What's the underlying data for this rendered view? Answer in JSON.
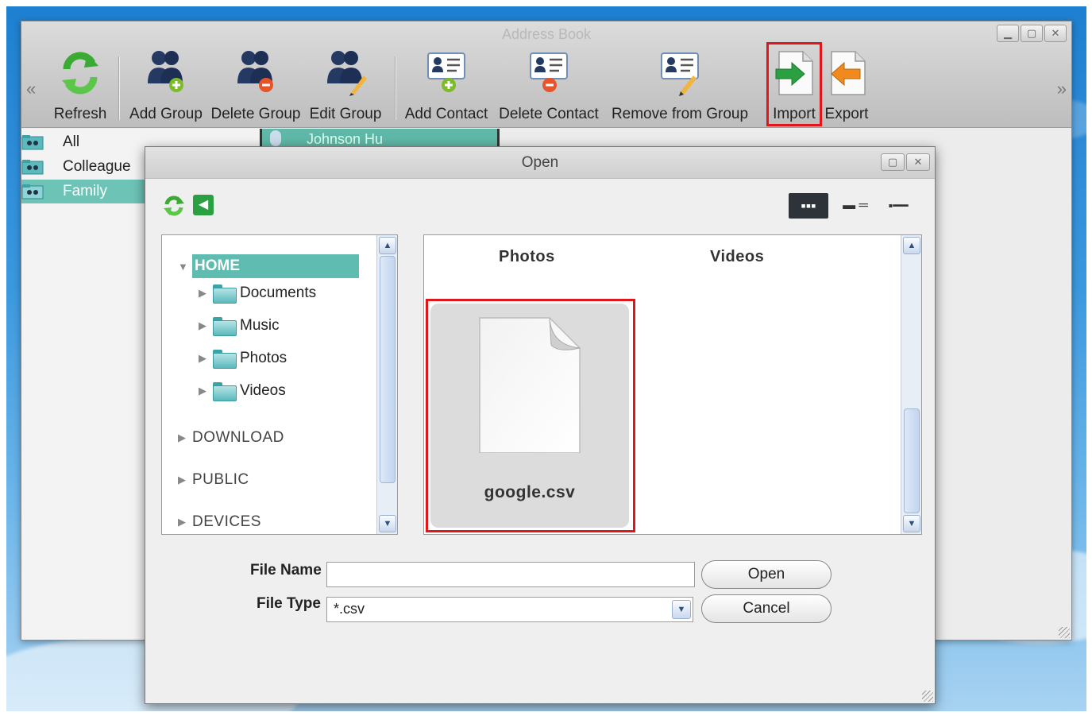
{
  "address_book": {
    "title": "Address Book",
    "window_controls": [
      "minimize",
      "maximize",
      "close"
    ],
    "toolbar": {
      "scroll_left": "«",
      "scroll_right": "»",
      "buttons": [
        {
          "label": "Refresh",
          "icon": "refresh-icon"
        },
        {
          "label": "Add Group",
          "icon": "add-group-icon"
        },
        {
          "label": "Delete Group",
          "icon": "delete-group-icon"
        },
        {
          "label": "Edit Group",
          "icon": "edit-group-icon"
        },
        {
          "label": "Add Contact",
          "icon": "add-contact-icon"
        },
        {
          "label": "Delete Contact",
          "icon": "delete-contact-icon"
        },
        {
          "label": "Remove from Group",
          "icon": "remove-from-group-icon"
        },
        {
          "label": "Import",
          "icon": "import-icon",
          "highlighted": true
        },
        {
          "label": "Export",
          "icon": "export-icon"
        }
      ]
    },
    "groups": [
      {
        "label": "All",
        "selected": false
      },
      {
        "label": "Colleague",
        "selected": false
      },
      {
        "label": "Family",
        "selected": true
      }
    ],
    "contact_row": "Johnson Hu"
  },
  "open_dialog": {
    "title": "Open",
    "tree": {
      "home": "HOME",
      "folders": [
        "Documents",
        "Music",
        "Photos",
        "Videos"
      ],
      "sections": [
        "DOWNLOAD",
        "PUBLIC",
        "DEVICES"
      ]
    },
    "files": {
      "top_items": [
        "Photos",
        "Videos"
      ],
      "selected_file": "google.csv"
    },
    "file_name_label": "File Name",
    "file_name_value": "",
    "file_type_label": "File Type",
    "file_type_value": "*.csv",
    "open_button": "Open",
    "cancel_button": "Cancel"
  },
  "colors": {
    "accent_teal": "#5fbcb0",
    "highlight_red": "#e0161b",
    "import_green": "#2aa043",
    "export_orange": "#f08a1e"
  }
}
